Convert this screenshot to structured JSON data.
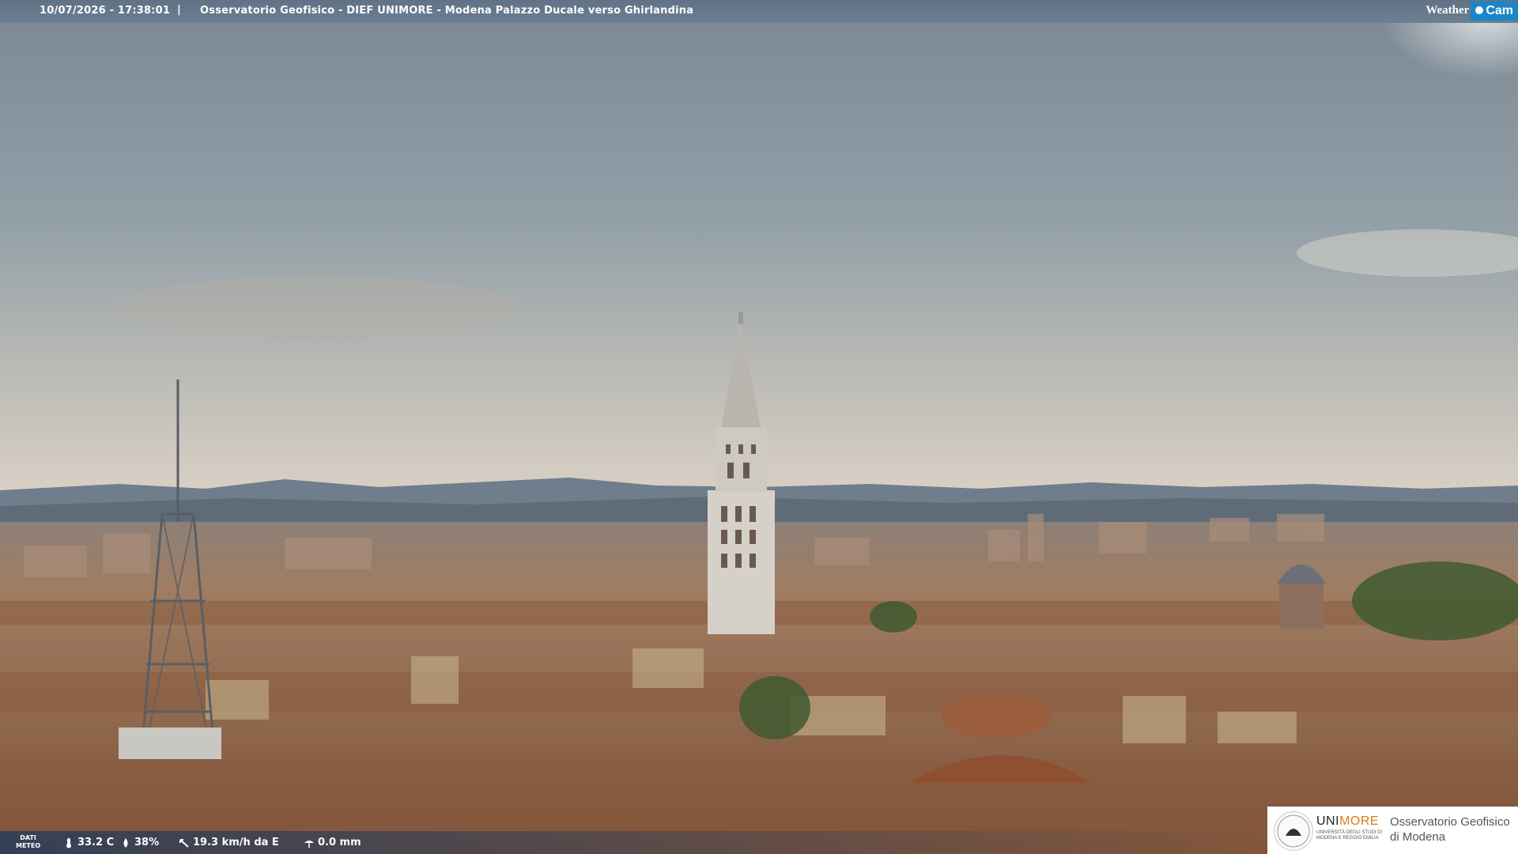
{
  "overlay": {
    "datetime": "10/07/2026 - 17:38:01",
    "separator": "|",
    "title": "Osservatorio Geofisico - DIEF UNIMORE - Modena Palazzo Ducale verso Ghirlandina",
    "brand_weather": "Weather",
    "brand_cam": "Cam"
  },
  "meteo": {
    "label_line1": "DATI",
    "label_line2": "METEO",
    "temperature": "33.2 C",
    "humidity": "38%",
    "wind": "19.3 km/h da E",
    "rain": "0.0 mm",
    "icons": [
      "thermometer-icon",
      "humidity-drop-icon",
      "wind-icon",
      "rain-icon"
    ]
  },
  "logo": {
    "uni_prefix": "UNI",
    "uni_suffix": "MORE",
    "uni_sub_line1": "UNIVERSITÀ DEGLI STUDI DI",
    "uni_sub_line2": "MODENA E REGGIO EMILIA",
    "obs_line1": "Osservatorio Geofisico",
    "obs_line2": "di Modena"
  },
  "scene": {
    "description_colors": {
      "sky_top": "#7e8c96",
      "sky_horizon": "#d9d0c6",
      "mountains": "#6c7a8a",
      "roofs": "#9c6a4a",
      "tower": "#d6d2ca",
      "accent": "#1a86c8"
    }
  }
}
